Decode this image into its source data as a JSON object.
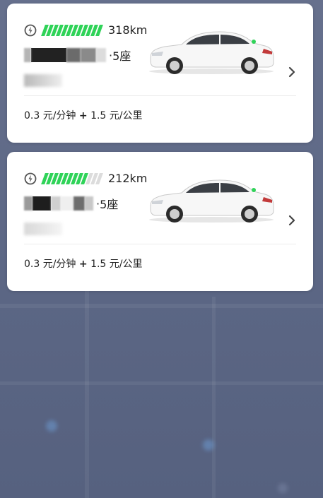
{
  "cards": [
    {
      "battery_level": 1.0,
      "range": "318km",
      "seats": "5座",
      "price_parts": [
        "0.3",
        "元/分钟",
        "+",
        "1.5",
        "元/公里"
      ],
      "icons": {
        "battery": "battery-charge-icon",
        "car": "car-image",
        "chevron": "chevron-right-icon"
      }
    },
    {
      "battery_level": 0.75,
      "range": "212km",
      "seats": "5座",
      "price_parts": [
        "0.3",
        "元/分钟",
        "+",
        "1.5",
        "元/公里"
      ],
      "icons": {
        "battery": "battery-charge-icon",
        "car": "car-image",
        "chevron": "chevron-right-icon"
      }
    }
  ],
  "colors": {
    "battery_fill": "#2fd358",
    "battery_empty": "#dcdcdc",
    "backdrop": "#5f6a88"
  }
}
